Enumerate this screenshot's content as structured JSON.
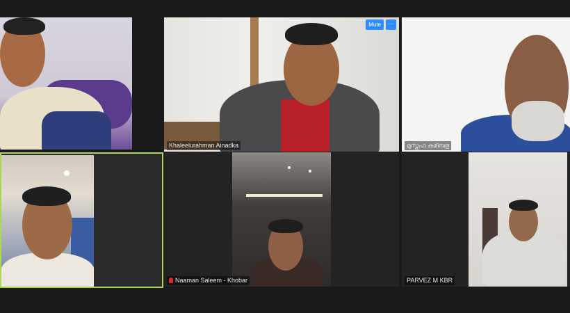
{
  "participants": [
    {
      "name": ""
    },
    {
      "name": "Khaleelurahman Ainadka",
      "mute_label": "Mute",
      "more_label": "···"
    },
    {
      "name": "മുസ്തഫ കുമ്ബള"
    },
    {
      "name": ""
    },
    {
      "name": "Naaman Saleem - Khobar"
    },
    {
      "name": "PARVEZ M KBR"
    }
  ],
  "colors": {
    "background": "#1a1a1a",
    "active_speaker_border": "#a9d65b",
    "button_blue": "#2d8cff",
    "muted_mic": "#e02828"
  }
}
